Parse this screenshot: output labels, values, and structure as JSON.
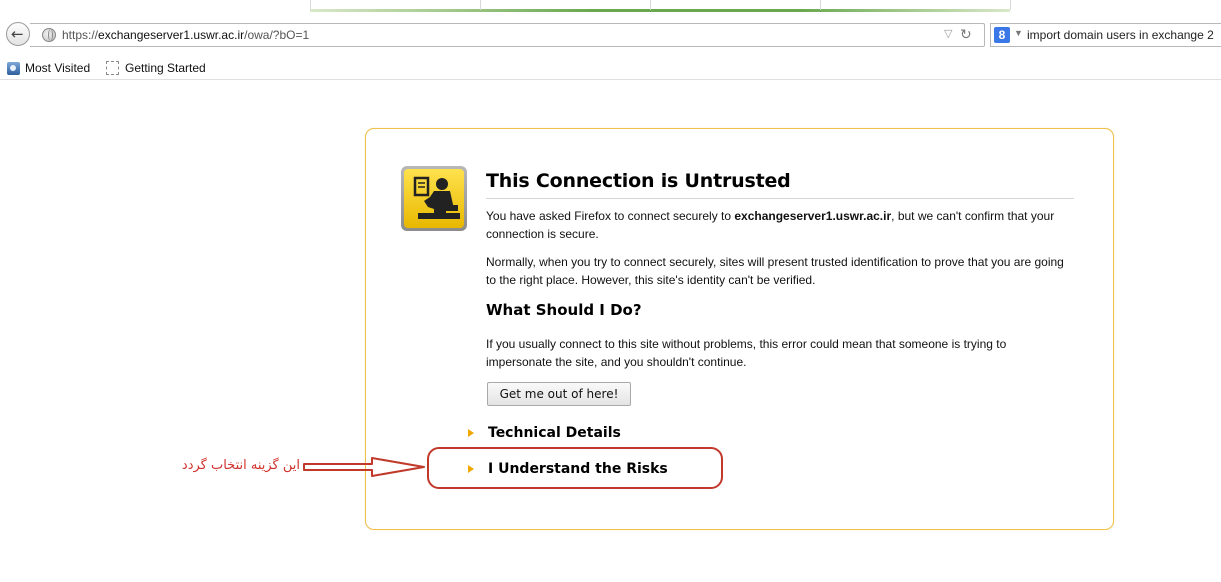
{
  "browser": {
    "url_scheme": "https://",
    "url_host": "exchangeserver1.uswr.ac.ir",
    "url_path": "/owa/?bO=1",
    "search_engine_icon": "8",
    "search_text": "import domain users in exchange 2",
    "bookmarks": [
      {
        "label": "Most Visited",
        "icon": "most-visited-icon"
      },
      {
        "label": "Getting Started",
        "icon": "page-icon"
      }
    ]
  },
  "error_page": {
    "title": "This Connection is Untrusted",
    "para1_before": "You have asked Firefox to connect securely to ",
    "para1_host": "exchangeserver1.uswr.ac.ir",
    "para1_after": ", but we can't confirm that your connection is secure.",
    "para2": "Normally, when you try to connect securely, sites will present trusted identification to prove that you are going to the right place. However, this site's identity can't be verified.",
    "subtitle": "What Should I Do?",
    "para3": "If you usually connect to this site without problems, this error could mean that someone is trying to impersonate the site, and you shouldn't continue.",
    "escape_button": "Get me out of here!",
    "technical_details": "Technical Details",
    "understand_risks": "I Understand the Risks"
  },
  "annotation": {
    "text": "این گزینه انتخاب گردد",
    "color": "#c0392b"
  },
  "colors": {
    "box_border": "#f0c14b",
    "expander_triangle": "#f0a800",
    "icon_yellow": "#ffd700"
  }
}
